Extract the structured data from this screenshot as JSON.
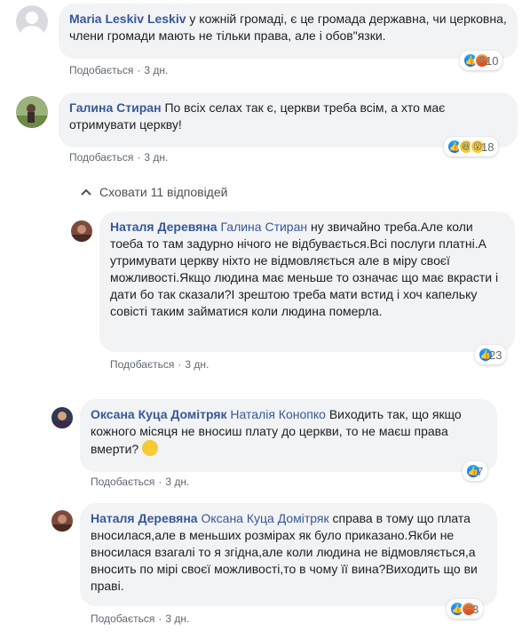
{
  "comments": [
    {
      "author": "Maria Leskiv Leskiv",
      "mention": "",
      "text": "у кожній громаді, є це громада державна, чи церковна, члени громади мають не тільки права, але і обов\"язки.",
      "like_label": "Подобається",
      "time": "3 дн.",
      "reaction_count": "10"
    },
    {
      "author": "Галина Стиран",
      "mention": "",
      "text": "По всіх селах так є, церкви треба всім, а хто має отримувати церкву!",
      "like_label": "Подобається",
      "time": "3 дн.",
      "reaction_count": "18"
    }
  ],
  "hide_replies_label": "Сховати 11 відповідей",
  "replies": [
    {
      "author": "Наталя Деревяна",
      "mention": "Галина Стиран",
      "text": "ну звичайно треба.Але коли тоеба то там задурно нічого не відбувається.Всі послуги платні.А утримувати церкву ніхто не відмовляється але в міру своєї можливості.Якщо людина має меньше то означає що має вкрасти і дати бо так сказали?І зрештою треба мати встид і хоч капельку совісті таким займатися коли людина померла.",
      "like_label": "Подобається",
      "time": "3 дн.",
      "reaction_count": "23"
    },
    {
      "author": "Оксана Куца Домітряк",
      "mention": "Наталія Конопко",
      "text": "Виходить так, що якщо кожного місяця не вносиш плату до церкви, то не маєш права вмерти?",
      "like_label": "Подобається",
      "time": "3 дн.",
      "reaction_count": "7"
    },
    {
      "author": "Наталя Деревяна",
      "mention": "Оксана Куца Домітряк",
      "text": "справа в тому що плата вносилася,але в меньших розмірах як було приказано.Якби не вносилася взагалі то я згідна,але коли людина не відмовляється,а вносить по мірі своєї можливості,то в чому її вина?Виходить що ви праві.",
      "like_label": "Подобається",
      "time": "3 дн.",
      "reaction_count": "3"
    }
  ],
  "colors": {
    "link": "#385898",
    "bubble": "#f2f3f5",
    "meta": "#606770"
  }
}
